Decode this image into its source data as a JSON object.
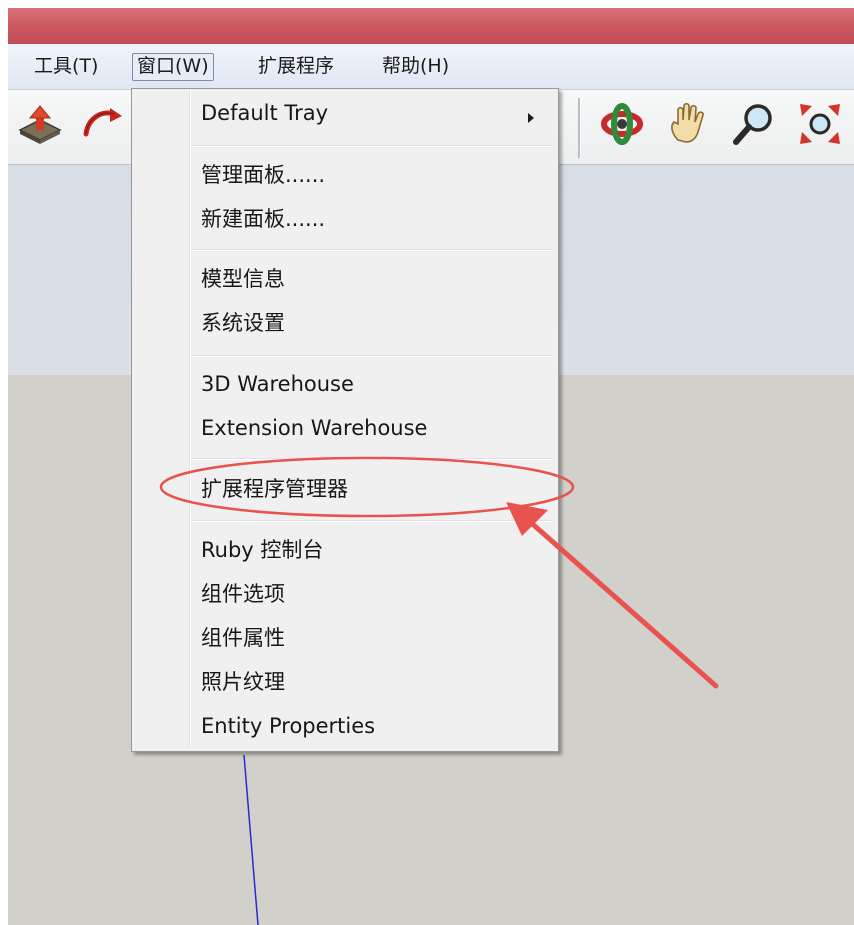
{
  "menubar": {
    "tools": "工具(T)",
    "window": "窗口(W)",
    "extensions": "扩展程序",
    "help": "帮助(H)"
  },
  "toolbar": {
    "icons": [
      "push-pull-icon",
      "follow-me-icon",
      "orbit-icon",
      "pan-hand-icon",
      "zoom-icon",
      "zoom-extents-icon"
    ]
  },
  "window_menu": {
    "items": [
      {
        "label": "Default Tray",
        "has_submenu": true
      },
      {
        "label": "管理面板......"
      },
      {
        "label": "新建面板......"
      },
      {
        "label": "模型信息"
      },
      {
        "label": "系统设置"
      },
      {
        "label": "3D Warehouse"
      },
      {
        "label": "Extension Warehouse"
      },
      {
        "label": "扩展程序管理器",
        "highlighted": true
      },
      {
        "label": "Ruby 控制台"
      },
      {
        "label": "组件选项"
      },
      {
        "label": "组件属性"
      },
      {
        "label": "照片纹理"
      },
      {
        "label": "Entity Properties"
      }
    ]
  },
  "annotation": {
    "color": "#e8524f",
    "target": "扩展程序管理器"
  },
  "colors": {
    "titlebar": "#cc5860",
    "menu_bg": "#f0f0f0",
    "ground": "#d1d0ca",
    "sky": "#dde2e8"
  }
}
